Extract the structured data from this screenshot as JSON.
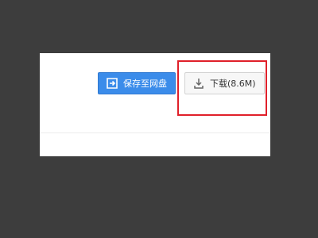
{
  "actions": {
    "save_label": "保存至网盘",
    "download_label": "下载(8.6M)"
  },
  "icons": {
    "save": "save-to-cloud-icon",
    "download": "download-icon"
  },
  "colors": {
    "primary_button": "#3b8cea",
    "highlight": "#e0202a",
    "background": "#3d3d3d"
  }
}
